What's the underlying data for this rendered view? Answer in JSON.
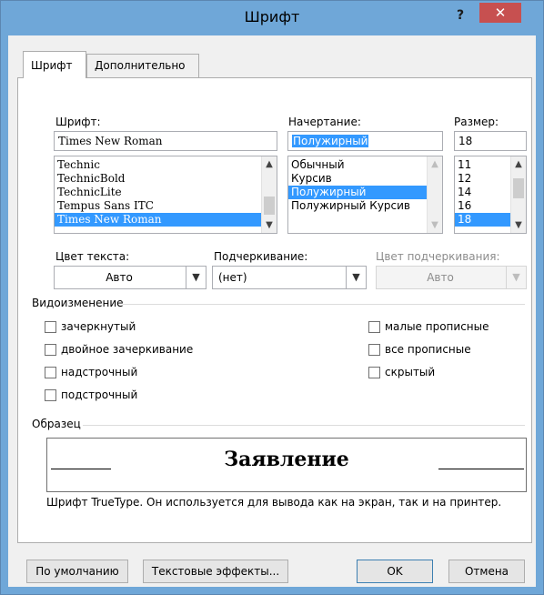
{
  "window": {
    "title": "Шрифт",
    "help": "?",
    "close": "✕"
  },
  "tabs": [
    {
      "label": "Шрифт"
    },
    {
      "label": "Дополнительно"
    }
  ],
  "font": {
    "label": "Шрифт:",
    "value": "Times New Roman",
    "list": [
      "Technic",
      "TechnicBold",
      "TechnicLite",
      "Tempus Sans ITC",
      "Times New Roman"
    ],
    "selected_index": 4
  },
  "style": {
    "label": "Начертание:",
    "value": "Полужирный",
    "list": [
      "Обычный",
      "Курсив",
      "Полужирный",
      "Полужирный Курсив"
    ],
    "selected_index": 2
  },
  "size": {
    "label": "Размер:",
    "value": "18",
    "list": [
      "11",
      "12",
      "14",
      "16",
      "18"
    ],
    "selected_index": 4
  },
  "text_color": {
    "label": "Цвет текста:",
    "value": "Авто"
  },
  "underline": {
    "label": "Подчеркивание:",
    "value": "(нет)"
  },
  "underline_color": {
    "label": "Цвет подчеркивания:",
    "value": "Авто"
  },
  "effects": {
    "title": "Видоизменение",
    "left": [
      "зачеркнутый",
      "двойное зачеркивание",
      "надстрочный",
      "подстрочный"
    ],
    "right": [
      "малые прописные",
      "все прописные",
      "скрытый"
    ]
  },
  "sample": {
    "title": "Образец",
    "text": "Заявление",
    "note": "Шрифт TrueType. Он используется для вывода как на экран, так и на принтер."
  },
  "buttons": {
    "default": "По умолчанию",
    "text_effects": "Текстовые эффекты...",
    "ok": "OK",
    "cancel": "Отмена"
  },
  "colors": {
    "accent": "#3399ff",
    "titlebar": "#6fa7d8",
    "close": "#c75050"
  }
}
